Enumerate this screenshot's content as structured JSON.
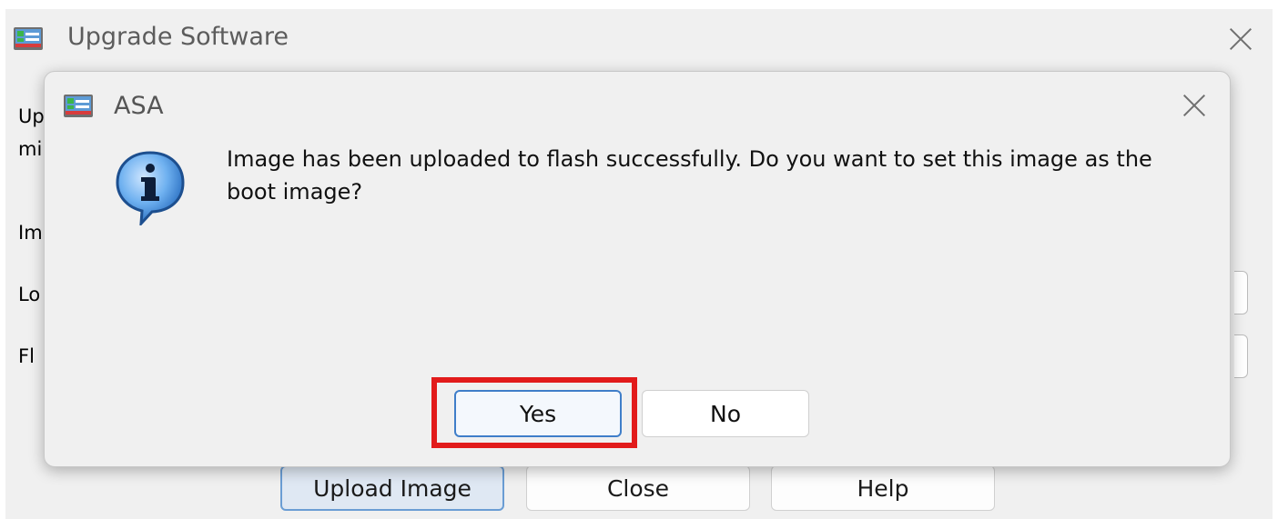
{
  "background_window": {
    "title": "Upgrade Software",
    "title_icon": "asa-app-icon",
    "close_icon": "close-icon",
    "peek_text": [
      "Up",
      "mi",
      "Im",
      "Lo",
      "Fl"
    ],
    "buttons": {
      "upload_image": "Upload Image",
      "close": "Close",
      "help": "Help"
    }
  },
  "dialog": {
    "title": "ASA",
    "title_icon": "asa-app-icon",
    "close_icon": "close-icon",
    "message_icon": "info-icon",
    "message": "Image has been uploaded to flash successfully. Do you want to set this image as the boot image?",
    "buttons": {
      "yes": "Yes",
      "no": "No"
    }
  },
  "colors": {
    "highlight": "#e21b1b",
    "focus_border": "#3f7ec9",
    "info_icon": "#3f86d9"
  }
}
